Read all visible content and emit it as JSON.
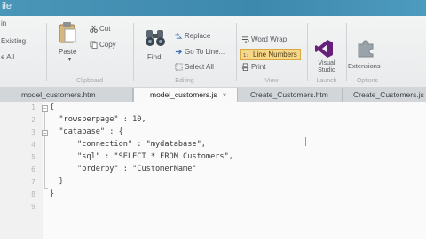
{
  "titlebar": {
    "text": "ile"
  },
  "ribbon": {
    "left_edge": {
      "in": "in",
      "existing": "Existing",
      "all": "e All"
    },
    "clipboard": {
      "paste": "Paste",
      "cut": "Cut",
      "copy": "Copy",
      "group": "Clipboard"
    },
    "editing": {
      "find": "Find",
      "replace": "Replace",
      "goto": "Go To Line...",
      "select_all": "Select All",
      "group": "Editing"
    },
    "view": {
      "word_wrap": "Word Wrap",
      "line_numbers": "Line Numbers",
      "print": "Print",
      "group": "View"
    },
    "launch": {
      "visual_studio": "Visual Studio",
      "group": "Launch"
    },
    "extensions": {
      "label": "Extensions",
      "group": "Options"
    }
  },
  "tabs": [
    {
      "label": "model_customers.htm",
      "active": false
    },
    {
      "label": "model_customers.js",
      "active": true,
      "close": "×"
    },
    {
      "label": "Create_Customers.htm",
      "active": false
    },
    {
      "label": "Create_Customers.js",
      "active": false
    }
  ],
  "editor": {
    "line_numbers": [
      "1",
      "2",
      "3",
      "4",
      "5",
      "6",
      "7",
      "8",
      "9"
    ],
    "lines": [
      "{",
      "  \"rowsperpage\" : 10,",
      "  \"database\" : {",
      "      \"connection\" : \"mydatabase\",",
      "      \"sql\" : \"SELECT * FROM Customers\",",
      "      \"orderby\" : \"CustomerName\"",
      "  }",
      "}",
      ""
    ]
  },
  "colors": {
    "ribbon_bg": "#eceeef",
    "line_numbers_highlight": "#f7d88a",
    "vs_purple": "#68217a",
    "tab_active": "#f9f9f9"
  }
}
